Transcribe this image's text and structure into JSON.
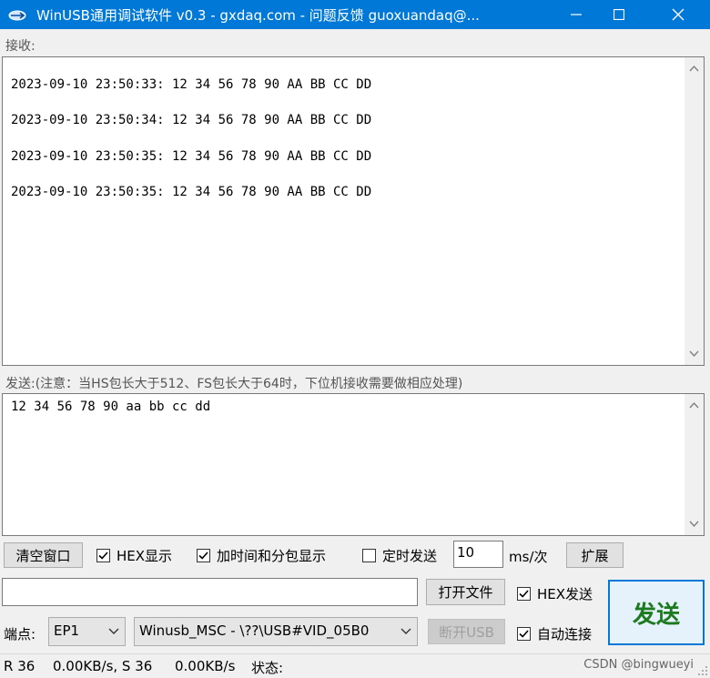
{
  "window": {
    "title": "WinUSB通用调试软件 v0.3 - gxdaq.com - 问题反馈 guoxuandaq@..."
  },
  "receive": {
    "label": "接收:",
    "lines": [
      "2023-09-10 23:50:33: 12 34 56 78 90 AA BB CC DD",
      "2023-09-10 23:50:34: 12 34 56 78 90 AA BB CC DD",
      "2023-09-10 23:50:35: 12 34 56 78 90 AA BB CC DD",
      "2023-09-10 23:50:35: 12 34 56 78 90 AA BB CC DD"
    ]
  },
  "send": {
    "label": "发送:(注意：当HS包长大于512、FS包长大于64时，下位机接收需要做相应处理)",
    "content": "12 34 56 78 90 aa bb cc dd"
  },
  "controls": {
    "clear_label": "清空窗口",
    "hex_display": {
      "label": "HEX显示",
      "checked": true
    },
    "timestamp": {
      "label": "加时间和分包显示",
      "checked": true
    },
    "timed_send": {
      "label": "定时发送",
      "checked": false
    },
    "interval_value": "10",
    "interval_unit": "ms/次",
    "expand_label": "扩展",
    "file_path_value": "",
    "open_file_label": "打开文件",
    "hex_send": {
      "label": "HEX发送",
      "checked": true
    },
    "send_label": "发送",
    "endpoint_label": "端点:",
    "endpoint_value": "EP1",
    "device_value": "Winusb_MSC - \\??\\USB#VID_05B0",
    "disconnect_label": "断开USB",
    "auto_connect": {
      "label": "自动连接",
      "checked": true
    }
  },
  "status": {
    "r_stats": "R 36",
    "r_rate": "0.00KB/s, S 36",
    "s_rate": "0.00KB/s",
    "state_label": "状态:",
    "watermark": "CSDN @bingwueyi"
  },
  "colors": {
    "titlebar": "#0078d7",
    "send_text": "#1e7a1e"
  }
}
